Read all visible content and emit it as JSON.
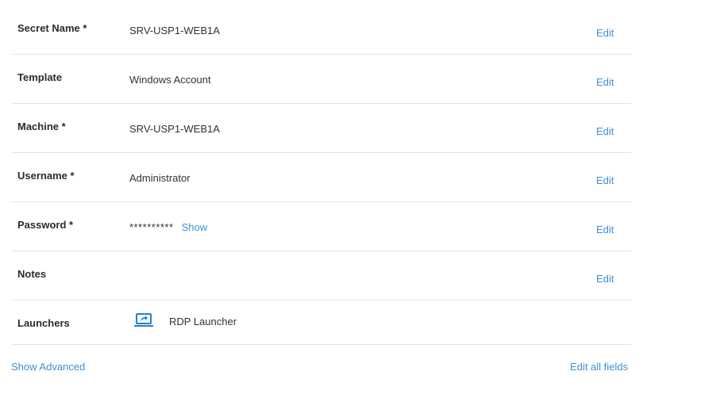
{
  "fields": [
    {
      "label": "Secret Name *",
      "value": "SRV-USP1-WEB1A",
      "edit": "Edit"
    },
    {
      "label": "Template",
      "value": "Windows Account",
      "edit": "Edit"
    },
    {
      "label": "Machine *",
      "value": "SRV-USP1-WEB1A",
      "edit": "Edit"
    },
    {
      "label": "Username *",
      "value": "Administrator",
      "edit": "Edit"
    },
    {
      "label": "Password *",
      "value": "**********",
      "show": "Show",
      "edit": "Edit"
    },
    {
      "label": "Notes",
      "value": "",
      "edit": "Edit"
    }
  ],
  "launchers": {
    "label": "Launchers",
    "icon": "rdp-launcher-icon",
    "item": "RDP Launcher"
  },
  "footer": {
    "show_advanced": "Show Advanced",
    "edit_all": "Edit all fields"
  },
  "colors": {
    "link": "#3d8fd9",
    "divider": "#e3e3e3"
  }
}
